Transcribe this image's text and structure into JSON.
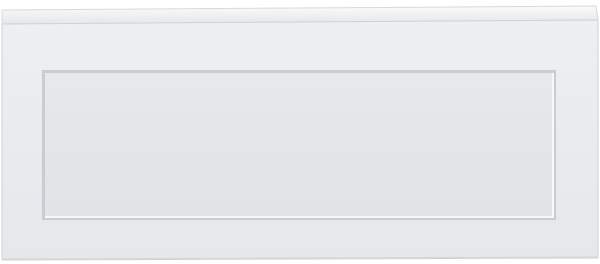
{
  "scene": {
    "subject": "bath-side-panel-icon",
    "colors": {
      "background": "#ffffff",
      "panel_face": "#e9ebee",
      "panel_top_edge": "#f3f4f6",
      "panel_outline": "#cfd2d6",
      "recess_face": "#e4e6e9",
      "recess_light": "#f7f8f9",
      "recess_shadow": "#c9ccd1"
    }
  }
}
